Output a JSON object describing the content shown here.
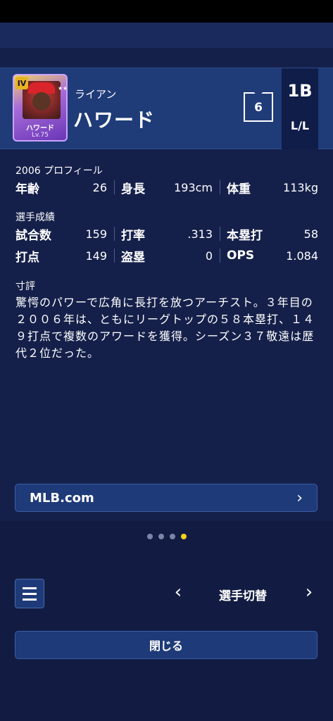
{
  "player": {
    "first_name": "ライアン",
    "last_name": "ハワード",
    "number": "6",
    "position": "1B",
    "bats_throws": "L/L",
    "card": {
      "rank": "IV",
      "name": "ハワード",
      "level": "Lv.75",
      "stars": "★★★★★★★"
    }
  },
  "profile": {
    "title": "2006 プロフィール",
    "age_label": "年齢",
    "age_value": "26",
    "height_label": "身長",
    "height_value": "193cm",
    "weight_label": "体重",
    "weight_value": "113kg"
  },
  "stats": {
    "title": "選手成績",
    "games_label": "試合数",
    "games_value": "159",
    "avg_label": "打率",
    "avg_value": ".313",
    "hr_label": "本塁打",
    "hr_value": "58",
    "rbi_label": "打点",
    "rbi_value": "149",
    "sb_label": "盗塁",
    "sb_value": "0",
    "ops_label": "OPS",
    "ops_value": "1.084"
  },
  "review": {
    "title": "寸評",
    "text": "驚愕のパワーで広角に長打を放つアーチスト。３年目の２００６年は、ともにリーグトップの５８本塁打、１４９打点で複数のアワードを獲得。シーズン３７敬遠は歴代２位だった。"
  },
  "links": {
    "mlb_label": "MLB.com",
    "mlb_arrow": "›"
  },
  "pager": {
    "total": 4,
    "active_index": 3
  },
  "nav": {
    "prev_arrow": "‹",
    "switch_label": "選手切替",
    "next_arrow": "›"
  },
  "footer": {
    "close_label": "閉じる"
  },
  "colors": {
    "background": "#15204a",
    "header": "#1f3b78",
    "active_dot": "#f5d21c"
  }
}
